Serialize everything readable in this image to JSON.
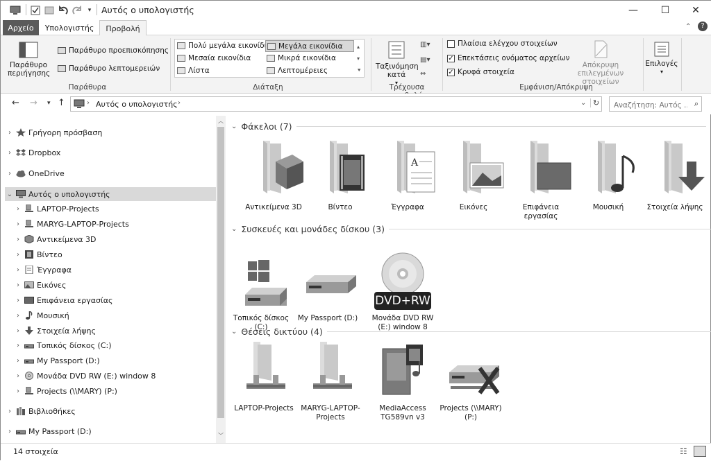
{
  "window": {
    "title": "Αυτός ο υπολογιστής",
    "controls": {
      "minimize": "—",
      "maximize": "☐",
      "close": "✕"
    }
  },
  "ribbon_tabs": [
    "Αρχείο",
    "Υπολογιστής",
    "Προβολή"
  ],
  "ribbon": {
    "panes": {
      "navigation_pane": "Παράθυρο περιήγησης",
      "preview_pane": "Παράθυρο προεπισκόπησης",
      "details_pane": "Παράθυρο λεπτομερειών",
      "group_label": "Παράθυρα"
    },
    "layout": {
      "options": [
        "Πολύ μεγάλα εικονίδια",
        "Μεγάλα εικονίδια",
        "Μεσαία εικονίδια",
        "Μικρά εικονίδια",
        "Λίστα",
        "Λεπτομέρειες"
      ],
      "selected": "Μεγάλα εικονίδια",
      "group_label": "Διάταξη"
    },
    "current_view": {
      "sort_by": "Ταξινόμηση κατά",
      "group_label": "Τρέχουσα προβολή"
    },
    "show_hide": {
      "item_check_boxes": {
        "label": "Πλαίσια ελέγχου στοιχείων",
        "checked": false
      },
      "file_extensions": {
        "label": "Επεκτάσεις ονόματος αρχείων",
        "checked": true
      },
      "hidden_items": {
        "label": "Κρυφά στοιχεία",
        "checked": true
      },
      "hide_selected": "Απόκρυψη επιλεγμένων στοιχείων",
      "group_label": "Εμφάνιση/Απόκρυψη"
    },
    "options": "Επιλογές"
  },
  "address_bar": {
    "path": "Αυτός ο υπολογιστής",
    "search_placeholder": "Αναζήτηση: Αυτός ..."
  },
  "nav_pane": {
    "items": [
      {
        "label": "Γρήγορη πρόσβαση",
        "icon": "star-icon",
        "level": 0
      },
      {
        "label": "Dropbox",
        "icon": "dropbox-icon",
        "level": 0
      },
      {
        "label": "OneDrive",
        "icon": "cloud-icon",
        "level": 0
      },
      {
        "label": "Αυτός ο υπολογιστής",
        "icon": "computer-icon",
        "level": 0,
        "expanded": true,
        "selected": true
      },
      {
        "label": "LAPTOP-Projects",
        "icon": "network-drive-icon",
        "level": 1
      },
      {
        "label": "MARYG-LAPTOP-Projects",
        "icon": "network-drive-icon",
        "level": 1
      },
      {
        "label": "Αντικείμενα 3D",
        "icon": "cube-icon",
        "level": 1
      },
      {
        "label": "Βίντεο",
        "icon": "film-icon",
        "level": 1
      },
      {
        "label": "Έγγραφα",
        "icon": "document-icon",
        "level": 1
      },
      {
        "label": "Εικόνες",
        "icon": "picture-icon",
        "level": 1
      },
      {
        "label": "Επιφάνεια εργασίας",
        "icon": "desktop-icon",
        "level": 1
      },
      {
        "label": "Μουσική",
        "icon": "music-icon",
        "level": 1
      },
      {
        "label": "Στοιχεία λήψης",
        "icon": "download-icon",
        "level": 1
      },
      {
        "label": "Τοπικός δίσκος (C:)",
        "icon": "hard-drive-icon",
        "level": 1
      },
      {
        "label": "My Passport (D:)",
        "icon": "hard-drive-icon",
        "level": 1
      },
      {
        "label": "Μονάδα DVD RW (E:) window 8",
        "icon": "dvd-icon",
        "level": 1
      },
      {
        "label": "Projects (\\\\MARY) (P:)",
        "icon": "network-drive-icon",
        "level": 1
      },
      {
        "label": "Βιβλιοθήκες",
        "icon": "library-icon",
        "level": 0
      },
      {
        "label": "My Passport (D:)",
        "icon": "hard-drive-icon",
        "level": 0
      }
    ]
  },
  "content": {
    "groups": [
      {
        "header": "Φάκελοι (7)",
        "items": [
          {
            "label": "Αντικείμενα 3D",
            "icon": "3d-objects-folder-icon"
          },
          {
            "label": "Βίντεο",
            "icon": "video-folder-icon"
          },
          {
            "label": "Έγγραφα",
            "icon": "documents-folder-icon"
          },
          {
            "label": "Εικόνες",
            "icon": "pictures-folder-icon"
          },
          {
            "label": "Επιφάνεια εργασίας",
            "icon": "desktop-folder-icon"
          },
          {
            "label": "Μουσική",
            "icon": "music-folder-icon"
          },
          {
            "label": "Στοιχεία λήψης",
            "icon": "downloads-folder-icon"
          }
        ]
      },
      {
        "header": "Συσκευές και μονάδες δίσκου (3)",
        "items": [
          {
            "label": "Τοπικός δίσκος (C:)",
            "icon": "windows-drive-icon"
          },
          {
            "label": "My Passport (D:)",
            "icon": "hard-drive-icon"
          },
          {
            "label": "Μονάδα DVD RW (E:) window 8",
            "icon": "dvd-drive-icon",
            "badge": "DVD+RW"
          }
        ]
      },
      {
        "header": "Θέσεις δικτύου (4)",
        "items": [
          {
            "label": "LAPTOP-Projects",
            "icon": "network-folder-icon"
          },
          {
            "label": "MARYG-LAPTOP-Projects",
            "icon": "network-folder-icon"
          },
          {
            "label": "MediaAccess TG589vn v3",
            "icon": "media-server-icon"
          },
          {
            "label": "Projects (\\\\MARY) (P:)",
            "icon": "disconnected-drive-icon"
          }
        ]
      }
    ]
  },
  "status_bar": {
    "item_count": "14 στοιχεία"
  }
}
